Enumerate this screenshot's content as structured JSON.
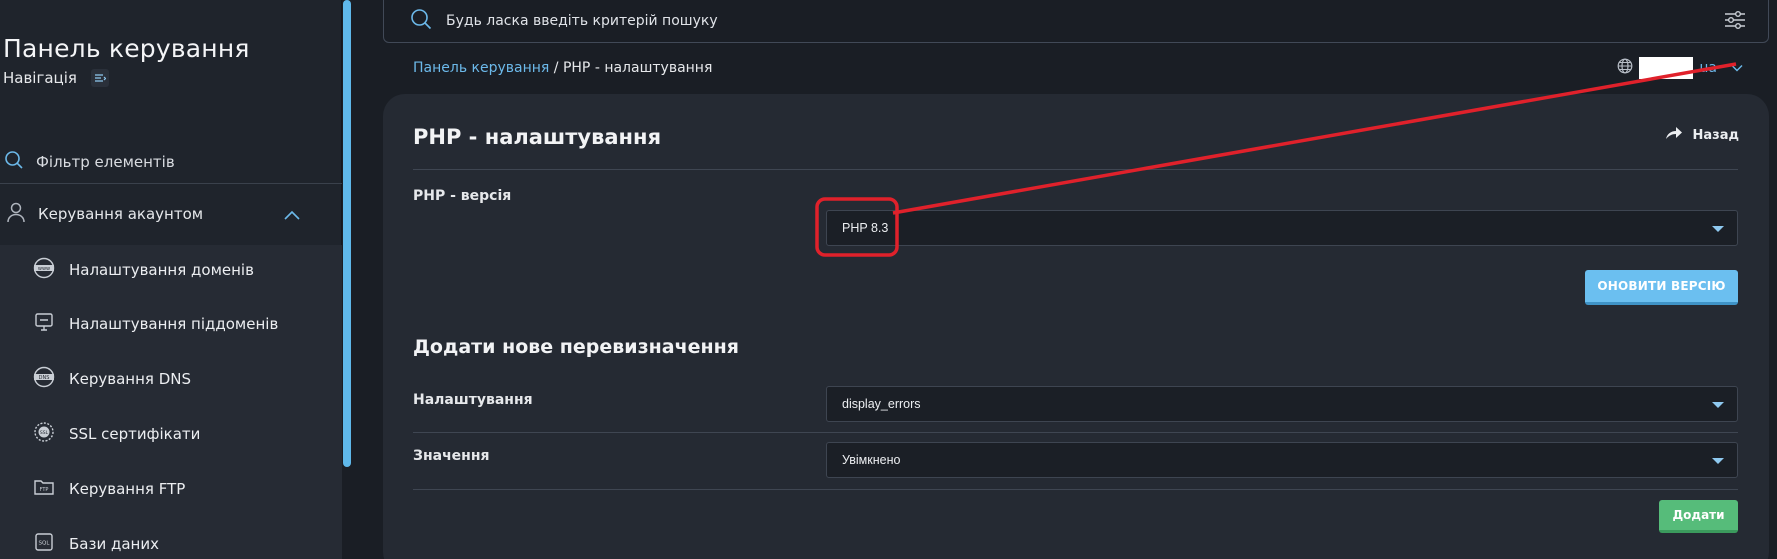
{
  "sidebar": {
    "title": "Панель керування",
    "nav_label": "Навігація",
    "filter_placeholder": "Фільтр елементів",
    "account_section": "Керування акаунтом",
    "items": [
      {
        "label": "Налаштування доменів",
        "icon": "www-globe-icon"
      },
      {
        "label": "Налаштування піддоменів",
        "icon": "monitor-icon"
      },
      {
        "label": "Керування DNS",
        "icon": "dns-globe-icon"
      },
      {
        "label": "SSL сертифікати",
        "icon": "ssl-badge-icon"
      },
      {
        "label": "Керування FTP",
        "icon": "ftp-folder-icon"
      },
      {
        "label": "Бази даних",
        "icon": "sql-database-icon"
      }
    ]
  },
  "search": {
    "placeholder": "Будь ласка введіть критерій пошуку"
  },
  "breadcrumb": {
    "root": "Панель керування",
    "separator": " / ",
    "current": "PHP - налаштування"
  },
  "domain_selector": {
    "suffix": ".ua"
  },
  "card": {
    "title": "PHP - налаштування",
    "back_label": "Назад",
    "php_version_label": "PHP - версія",
    "php_version_value": "PHP 8.3",
    "update_button": "ОНОВИТИ ВЕРСІЮ",
    "override_section_title": "Додати нове перевизначення",
    "setting_label": "Налаштування",
    "setting_value": "display_errors",
    "value_label": "Значення",
    "value_value": "Увімкнено",
    "add_button": "Додати"
  },
  "colors": {
    "accent_blue": "#6bbff0",
    "link_blue": "#6cb9ea",
    "add_green": "#56bc7a",
    "annotation_red": "#e0212b"
  }
}
